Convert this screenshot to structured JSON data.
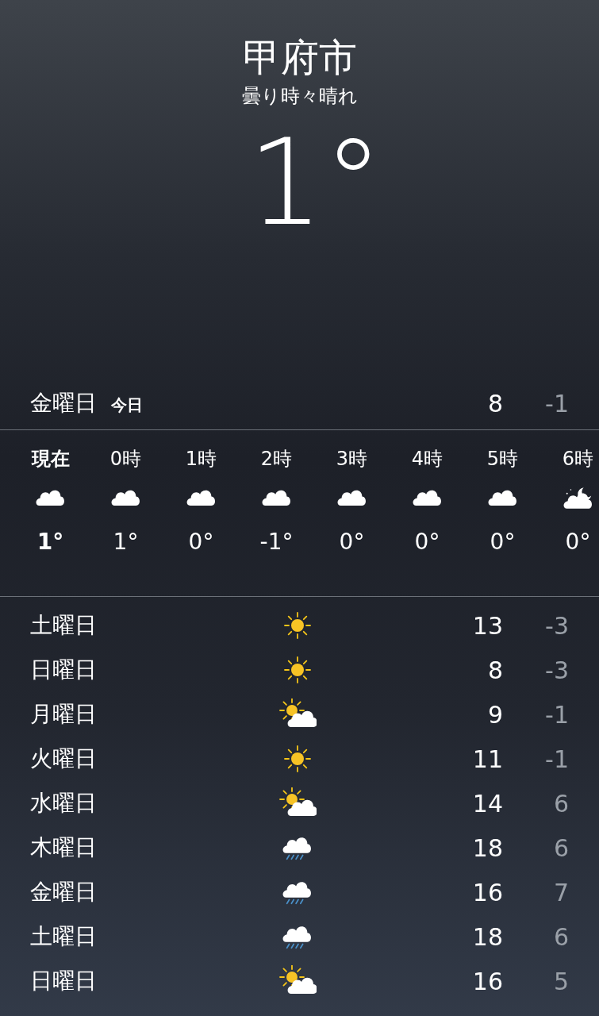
{
  "location": {
    "city": "甲府市",
    "condition": "曇り時々晴れ",
    "temperature": "1°"
  },
  "today": {
    "day": "金曜日",
    "label": "今日",
    "high": "8",
    "low": "-1"
  },
  "hourly": [
    {
      "time": "現在",
      "kind": "cloud",
      "temp": "1°",
      "current": true
    },
    {
      "time": "0時",
      "kind": "cloud",
      "temp": "1°",
      "current": false
    },
    {
      "time": "1時",
      "kind": "cloud",
      "temp": "0°",
      "current": false
    },
    {
      "time": "2時",
      "kind": "cloud",
      "temp": "-1°",
      "current": false
    },
    {
      "time": "3時",
      "kind": "cloud",
      "temp": "0°",
      "current": false
    },
    {
      "time": "4時",
      "kind": "cloud",
      "temp": "0°",
      "current": false
    },
    {
      "time": "5時",
      "kind": "cloud",
      "temp": "0°",
      "current": false
    },
    {
      "time": "6時",
      "kind": "cloud-night",
      "temp": "0°",
      "current": false
    }
  ],
  "daily": [
    {
      "day": "土曜日",
      "kind": "sun",
      "high": "13",
      "low": "-3"
    },
    {
      "day": "日曜日",
      "kind": "sun",
      "high": "8",
      "low": "-3"
    },
    {
      "day": "月曜日",
      "kind": "sun-cloud",
      "high": "9",
      "low": "-1"
    },
    {
      "day": "火曜日",
      "kind": "sun",
      "high": "11",
      "low": "-1"
    },
    {
      "day": "水曜日",
      "kind": "sun-cloud",
      "high": "14",
      "low": "6"
    },
    {
      "day": "木曜日",
      "kind": "rain",
      "high": "18",
      "low": "6"
    },
    {
      "day": "金曜日",
      "kind": "rain",
      "high": "16",
      "low": "7"
    },
    {
      "day": "土曜日",
      "kind": "rain",
      "high": "18",
      "low": "6"
    },
    {
      "day": "日曜日",
      "kind": "sun-cloud",
      "high": "16",
      "low": "5"
    }
  ]
}
